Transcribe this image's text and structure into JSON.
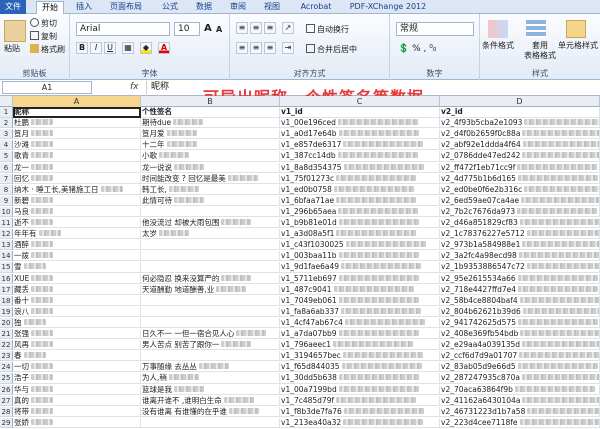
{
  "tabs": [
    "开始",
    "插入",
    "页面布局",
    "公式",
    "数据",
    "审阅",
    "视图",
    "Acrobat",
    "PDF-XChange 2012"
  ],
  "active_tab": "开始",
  "ribbon": {
    "clipboard": {
      "paste": "粘贴",
      "cut": "剪切",
      "copy": "复制",
      "painter": "格式刷",
      "label": "剪贴板"
    },
    "font": {
      "name": "Arial",
      "size": "10",
      "grow": "A",
      "shrink": "A",
      "bold": "B",
      "italic": "I",
      "underline": "U",
      "label": "字体"
    },
    "alignment": {
      "wrap": "自动换行",
      "merge": "合并后居中",
      "label": "对齐方式"
    },
    "number": {
      "format": "常规",
      "label": "数字"
    },
    "styles": {
      "conditional": "条件格式",
      "table": "套用\n表格格式",
      "cell": "单元格样式",
      "label": "样式"
    }
  },
  "formula_bar": {
    "cell": "A1",
    "fx": "fx",
    "content": "昵称"
  },
  "caption": "可导出昵称、个性签名等数据",
  "columns": [
    "A",
    "B",
    "C",
    "D"
  ],
  "headers": {
    "a": "昵称",
    "b": "个性签名",
    "c": "v1_id",
    "d": "v2_id"
  },
  "rows": [
    {
      "n": "2",
      "a": "杜鹏",
      "b": "期待due",
      "c": "v1_00e196ced",
      "d": "v2_4f93b5cba2e1093"
    },
    {
      "n": "3",
      "a": "笪月",
      "b": "笪月爱",
      "c": "v1_a0d17e64b",
      "d": "v2_d4f0b2659f0c88a"
    },
    {
      "n": "4",
      "a": "沙滩",
      "b": "十二年",
      "c": "v1_e857de6317",
      "d": "v2_abf92e1ddda4f64"
    },
    {
      "n": "5",
      "a": "歌青",
      "b": "小歌",
      "c": "v1_387cc14db",
      "d": "v2_0786dde47ed242"
    },
    {
      "n": "6",
      "a": "龙一",
      "b": "龙一说说",
      "c": "v1_8a8d354375",
      "d": "v2_ff472f1eb71cc9f"
    },
    {
      "n": "7",
      "a": "回忆",
      "b": "时间能改变 ? 回忆是最美",
      "c": "v1_75f01273c",
      "d": "v2_4d775b1b6d165"
    },
    {
      "n": "8",
      "a": "纳木  · 睡工长,美猪施工日",
      "b": "韩工长,",
      "c": "v1_ed0b0758",
      "d": "v2_ed0be0f6e2b316c"
    },
    {
      "n": "9",
      "a": "新碧",
      "b": "此情可待",
      "c": "v1_6bfaa71ae",
      "d": "v2_6ed59ae07ca4ae"
    },
    {
      "n": "10",
      "a": "马良",
      "b": "",
      "c": "v1_296b65aea",
      "d": "v2_7b2c7676da973"
    },
    {
      "n": "11",
      "a": "逝不",
      "b": "他没流过 却被大雨包围",
      "c": "v1_b9b81e01d",
      "d": "v2_d46a851829cf83"
    },
    {
      "n": "12",
      "a": "年年有",
      "b": "太岁",
      "c": "v1_a3d08a5f1",
      "d": "v2_1c78376227e5712"
    },
    {
      "n": "13",
      "a": "酒醉",
      "b": "",
      "c": "v1_c43f1030025",
      "d": "v2_973b1a584988e1"
    },
    {
      "n": "14",
      "a": "一拨",
      "b": "",
      "c": "v1_003baa11b",
      "d": "v2_3a2fc4a98ecd98"
    },
    {
      "n": "15",
      "a": "雪",
      "b": "",
      "c": "v1_9d1fae6a49",
      "d": "v2_1b9353886547c72"
    },
    {
      "n": "16",
      "a": "XUE",
      "b": "何必隐忍 换来没算严的",
      "c": "v1_5711eb697",
      "d": "v2_95e2615534a66"
    },
    {
      "n": "17",
      "a": "藏丢",
      "b": "天道酬勤 地道酬善,业",
      "c": "v1_487c9041",
      "d": "v2_718e4427ffd7e4"
    },
    {
      "n": "18",
      "a": "番十",
      "b": "",
      "c": "v1_7049eb061",
      "d": "v2_58b4ce8804baf4"
    },
    {
      "n": "19",
      "a": "浪八",
      "b": "",
      "c": "v1_fa8a6ab337",
      "d": "v2_804b62621b39d6"
    },
    {
      "n": "20",
      "a": "独",
      "b": "",
      "c": "v1_4cf47ab67c4",
      "d": "v2_941742625d575"
    },
    {
      "n": "21",
      "a": "张强",
      "b": "日久不一 一但一宿合见人心",
      "c": "v1_a7da07bb9",
      "d": "v2_408e369fb54bdb"
    },
    {
      "n": "22",
      "a": "风再",
      "b": "男人苦点 别苦了跟你一",
      "c": "v1_796aeec1",
      "d": "v2_e29aa4a039135d"
    },
    {
      "n": "23",
      "a": "春",
      "b": "",
      "c": "v1_3194657bec",
      "d": "v2_ccf6d7d9a01707"
    },
    {
      "n": "24",
      "a": "一切",
      "b": "万事随缘 去丛丛",
      "c": "v1_f65d844035",
      "d": "v2_83ab05d9e66d5"
    },
    {
      "n": "25",
      "a": "浩子",
      "b": "为人,稍",
      "c": "v1_30dd5b638",
      "d": "v2_287247935c870a"
    },
    {
      "n": "26",
      "a": "华与",
      "b": "篮球是我",
      "c": "v1_00a7199bd",
      "d": "v2_70aca63864f9b"
    },
    {
      "n": "27",
      "a": "真的",
      "b": "谁离开谁不 ,谁明白生命",
      "c": "v1_7c485d79f",
      "d": "v2_41162a6430104a"
    },
    {
      "n": "28",
      "a": "将带",
      "b": "没有谁离 有谁懂的在乎谁",
      "c": "v1_f8b3de7fa76",
      "d": "v2_46731223d1b7a58"
    },
    {
      "n": "29",
      "a": "张娇",
      "b": "",
      "c": "v1_213ea40a32",
      "d": "v2_223d4cee7118fe"
    }
  ]
}
